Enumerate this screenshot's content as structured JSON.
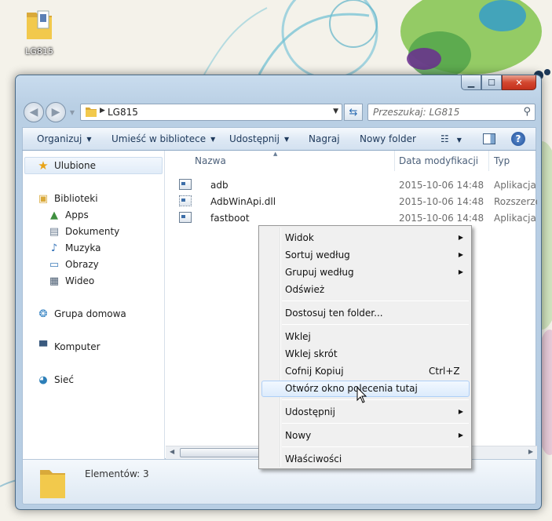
{
  "desktop": {
    "icon_label": "LG815"
  },
  "window": {
    "address": {
      "current_folder": "LG815"
    },
    "search": {
      "placeholder": "Przeszukaj: LG815"
    },
    "toolbar": {
      "organize": "Organizuj",
      "include_in_library": "Umieść w bibliotece",
      "share": "Udostępnij",
      "burn": "Nagraj",
      "new_folder": "Nowy folder"
    },
    "nav": {
      "favorites": "Ulubione",
      "libraries": "Biblioteki",
      "library_items": [
        "Apps",
        "Dokumenty",
        "Muzyka",
        "Obrazy",
        "Wideo"
      ],
      "homegroup": "Grupa domowa",
      "computer": "Komputer",
      "network": "Sieć"
    },
    "columns": {
      "name": "Nazwa",
      "date": "Data modyfikacji",
      "type": "Typ"
    },
    "files": [
      {
        "name": "adb",
        "date": "2015-10-06 14:48",
        "type": "Aplikacja"
      },
      {
        "name": "AdbWinApi.dll",
        "date": "2015-10-06 14:48",
        "type": "Rozszerzenie a"
      },
      {
        "name": "fastboot",
        "date": "2015-10-06 14:48",
        "type": "Aplikacja"
      }
    ],
    "details": {
      "item_count": "Elementów: 3"
    }
  },
  "context_menu": {
    "items": [
      {
        "label": "Widok",
        "submenu": true
      },
      {
        "label": "Sortuj według",
        "submenu": true
      },
      {
        "label": "Grupuj według",
        "submenu": true
      },
      {
        "label": "Odśwież",
        "submenu": false
      },
      {
        "label": "Dostosuj ten folder...",
        "submenu": false
      },
      {
        "label": "Wklej",
        "submenu": false
      },
      {
        "label": "Wklej skrót",
        "submenu": false
      },
      {
        "label": "Cofnij Kopiuj",
        "submenu": false,
        "shortcut": "Ctrl+Z"
      },
      {
        "label": "Otwórz okno polecenia tutaj",
        "submenu": false,
        "highlighted": true
      },
      {
        "label": "Udostępnij",
        "submenu": true
      },
      {
        "label": "Nowy",
        "submenu": true
      },
      {
        "label": "Właściwości",
        "submenu": false
      }
    ]
  },
  "colors": {
    "window_frame": "#b9cfe4",
    "menu_highlight": "#dcebfc",
    "help_blue": "#1f4f99",
    "folder_yellow": "#f2c94c"
  }
}
